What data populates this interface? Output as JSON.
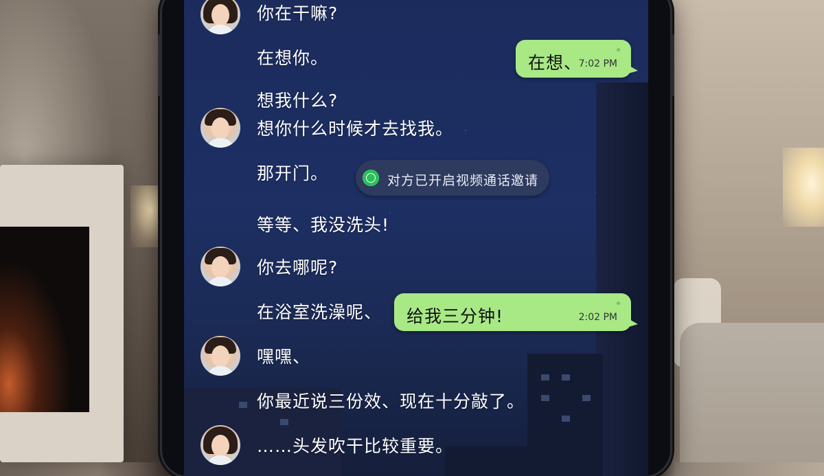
{
  "messages": [
    {
      "id": "m1",
      "text": "你在干嘛?"
    },
    {
      "id": "m2",
      "text": "在想你。"
    },
    {
      "id": "m3",
      "text": "想我什么?"
    },
    {
      "id": "m4",
      "text": "想你什么时候才去找我。"
    },
    {
      "id": "m5",
      "text": "那开门。"
    },
    {
      "id": "m6",
      "text": "等等、我没洗头!"
    },
    {
      "id": "m7",
      "text": "你去哪呢?"
    },
    {
      "id": "m8",
      "text": "在浴室洗澡呢、"
    },
    {
      "id": "m9",
      "text": "嘿嘿、"
    },
    {
      "id": "m10",
      "text": "你最近说三份效、现在十分敲了。"
    },
    {
      "id": "m11",
      "text": "……头发吹干比较重要。"
    }
  ],
  "bubbles": [
    {
      "id": "b1",
      "text": "在想、",
      "meta": "7:02 PM"
    },
    {
      "id": "b2",
      "text": "给我三分钟!",
      "meta": "2:02 PM"
    }
  ],
  "system_notice": {
    "text": "对方已开启视频通话邀请",
    "color": "#2ac05b"
  },
  "colors": {
    "bubble": "#a8e986",
    "screen": "#1d2f63"
  }
}
